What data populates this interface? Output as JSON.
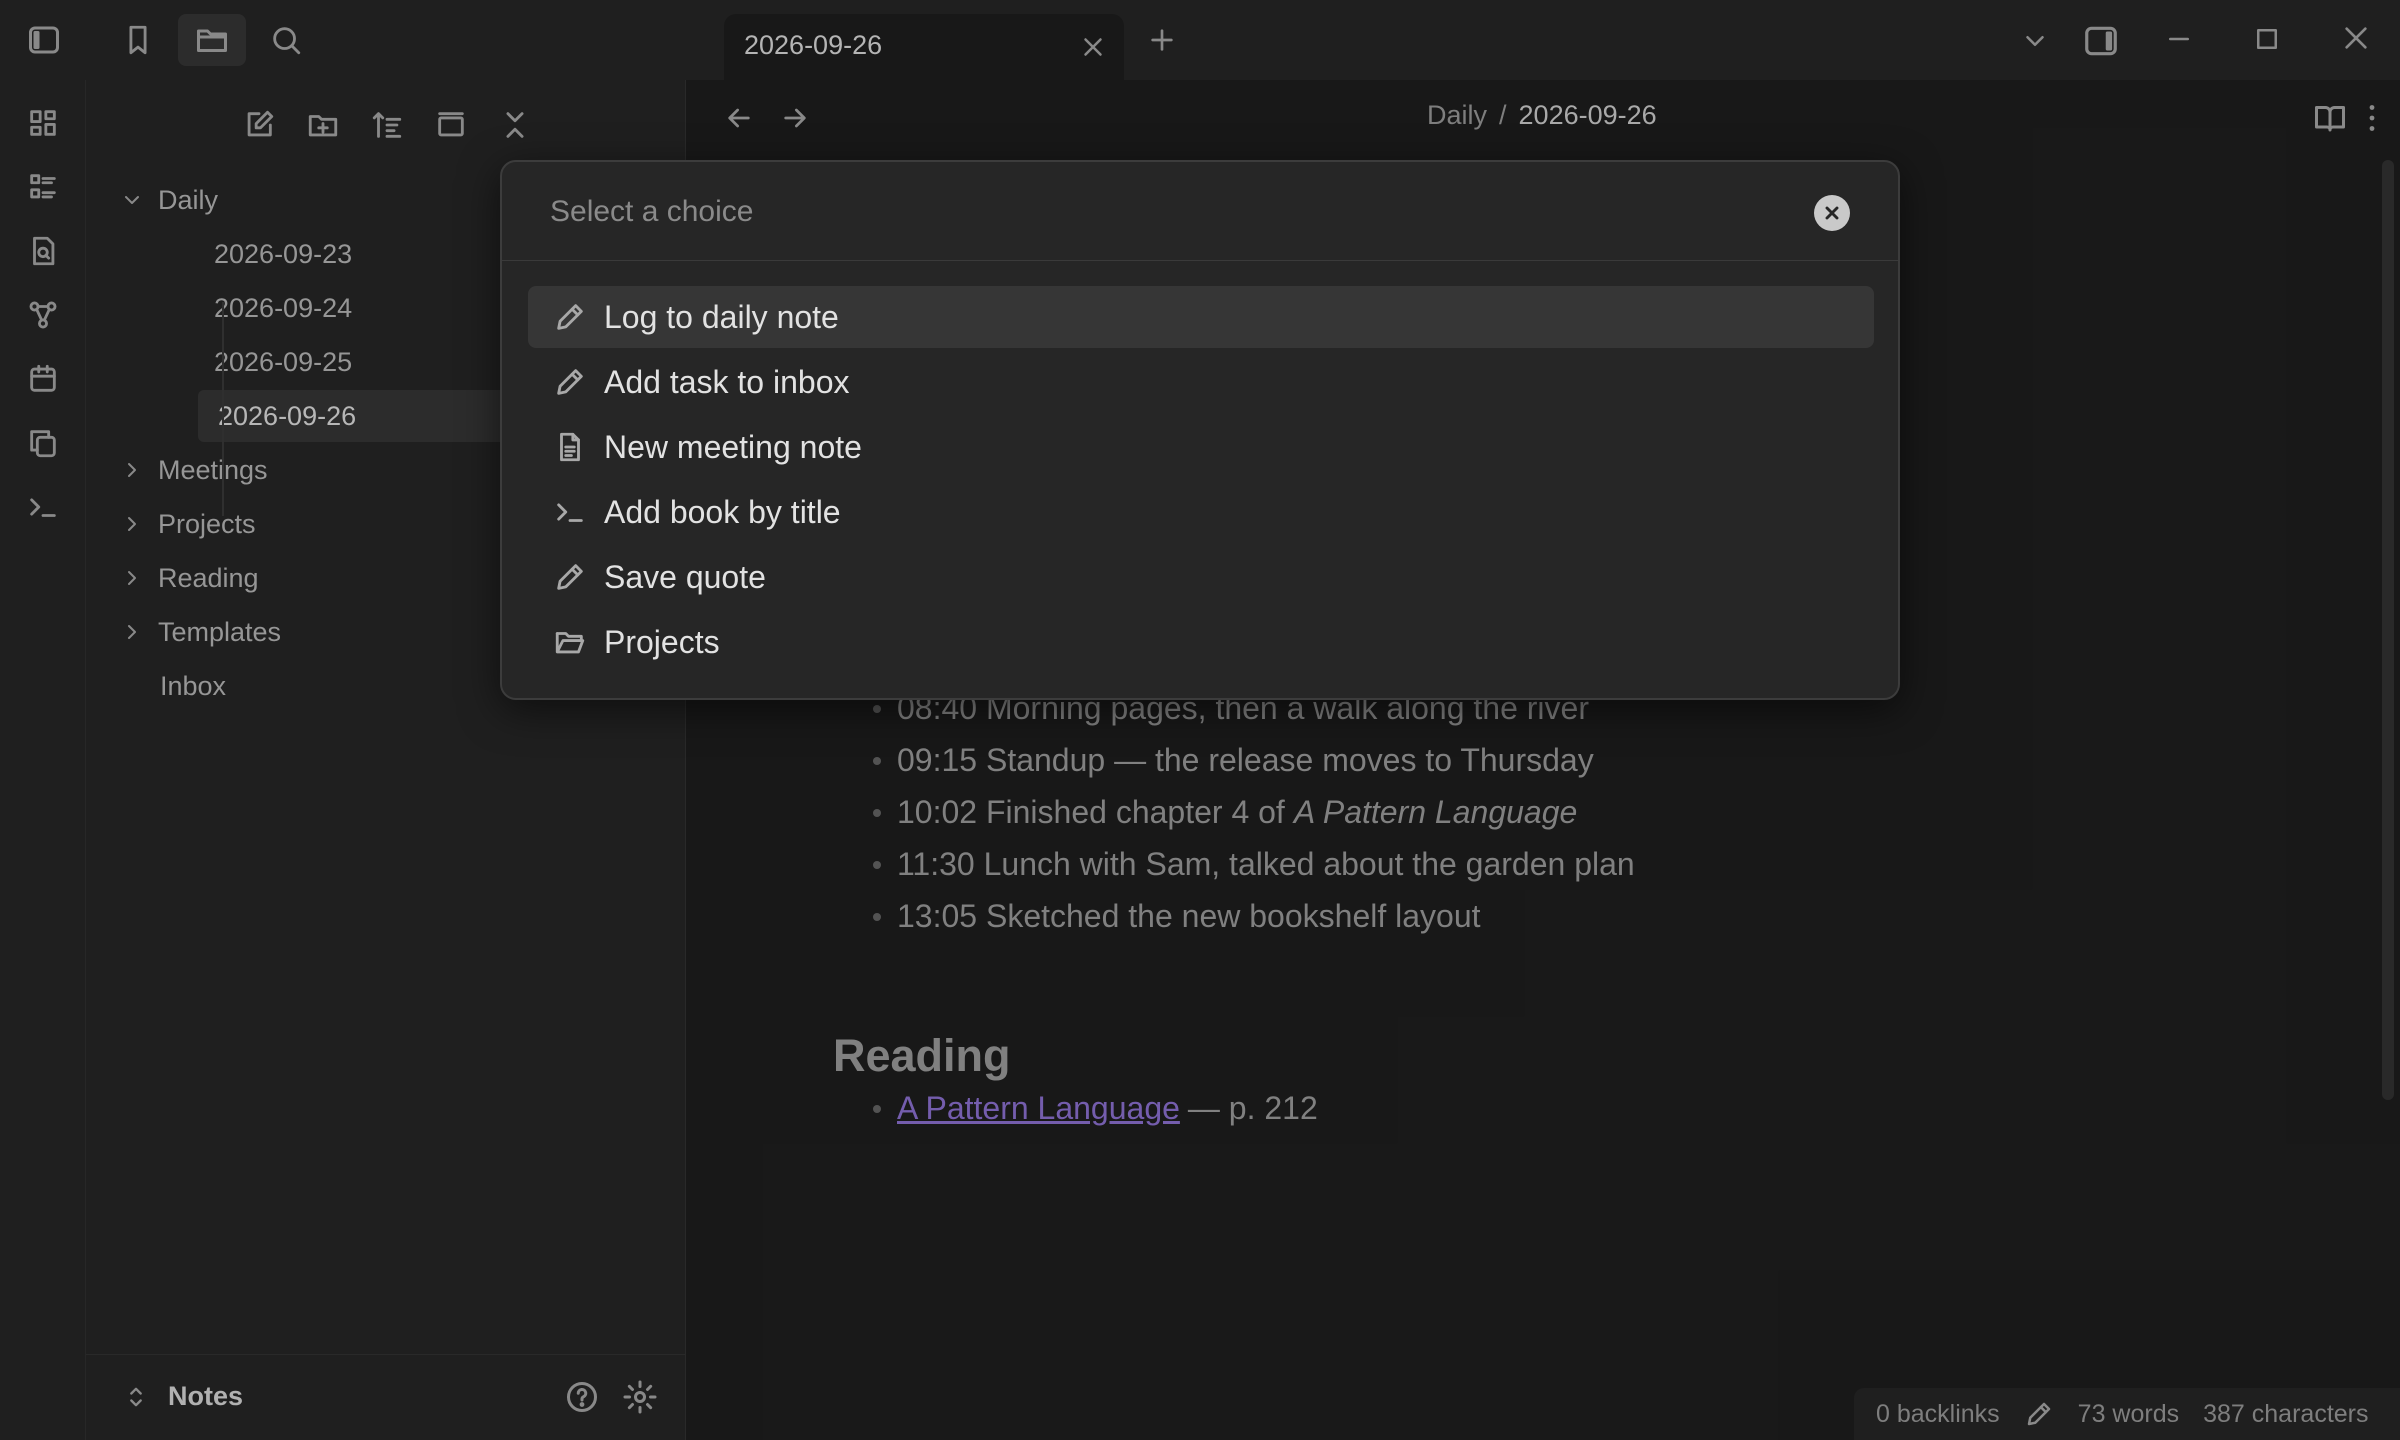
{
  "tab": {
    "title": "2026-09-26"
  },
  "icons": {
    "toggle_sidebar": "sidebar-left-icon",
    "bookmarks": "bookmark-icon",
    "files": "folder-icon",
    "search": "search-icon",
    "tab_close": "close-icon",
    "new_tab": "plus-icon",
    "tab_list": "chevron-down-icon",
    "right_sidebar": "sidebar-right-icon",
    "minimize": "minimize-icon",
    "maximize": "maximize-icon",
    "close_window": "close-icon"
  },
  "ribbon": [
    "dashboard-icon",
    "list-icon",
    "file-search-icon",
    "graph-icon",
    "calendar-icon",
    "copy-icon",
    "terminal-icon"
  ],
  "sidebar": {
    "tools": [
      "new-note-icon",
      "new-folder-icon",
      "sort-icon",
      "layout-icon",
      "collapse-all-icon"
    ],
    "tree": {
      "daily": {
        "label": "Daily",
        "files": [
          "2026-09-23",
          "2026-09-24",
          "2026-09-25",
          "2026-09-26"
        ],
        "active": "2026-09-26"
      },
      "folders": [
        "Meetings",
        "Projects",
        "Reading",
        "Templates"
      ],
      "root_files": [
        "Inbox"
      ]
    },
    "vault_name": "Notes"
  },
  "breadcrumb": {
    "folder": "Daily",
    "separator": "/",
    "note": "2026-09-26"
  },
  "note": {
    "log": [
      {
        "text": "08:40 Morning pages, then a walk along the river"
      },
      {
        "text": "09:15 Standup — the release moves to Thursday"
      },
      {
        "text": "10:02 Finished chapter 4 of",
        "italic": "A Pattern Language"
      },
      {
        "text": "11:30 Lunch with Sam, talked about the garden plan"
      },
      {
        "text": "13:05 Sketched the new bookshelf layout"
      }
    ],
    "reading_heading": "Reading",
    "reading_link": "A Pattern Language",
    "reading_suffix": "— p. 212"
  },
  "status": {
    "backlinks": "0 backlinks",
    "words": "73 words",
    "characters": "387 characters"
  },
  "modal": {
    "placeholder": "Select a choice",
    "choices": [
      {
        "label": "Log to daily note",
        "icon": "pencil-icon",
        "selected": true
      },
      {
        "label": "Add task to inbox",
        "icon": "pencil-icon"
      },
      {
        "label": "New meeting note",
        "icon": "file-text-icon"
      },
      {
        "label": "Add book by title",
        "icon": "terminal-icon"
      },
      {
        "label": "Save quote",
        "icon": "pencil-icon"
      },
      {
        "label": "Projects",
        "icon": "folder-open-icon"
      }
    ]
  },
  "colors": {
    "accent": "#8e72d4",
    "background": "#1e1e1e",
    "panel": "#262626"
  }
}
